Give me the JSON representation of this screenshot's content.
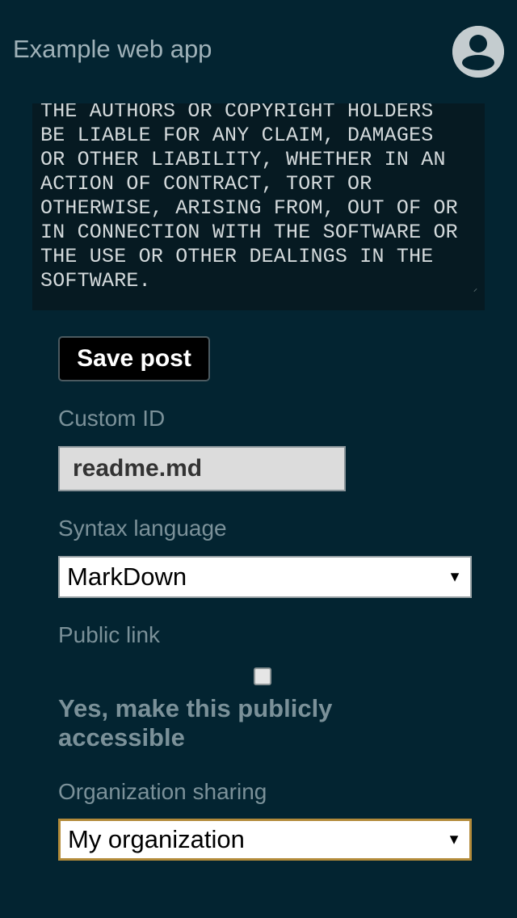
{
  "header": {
    "title": "Example web app",
    "avatar_icon": "account-circle-icon"
  },
  "editor": {
    "content": "THE AUTHORS OR COPYRIGHT HOLDERS\nBE LIABLE FOR ANY CLAIM, DAMAGES\nOR OTHER LIABILITY, WHETHER IN AN\nACTION OF CONTRACT, TORT OR\nOTHERWISE, ARISING FROM, OUT OF OR\nIN CONNECTION WITH THE SOFTWARE OR\nTHE USE OR OTHER DEALINGS IN THE\nSOFTWARE."
  },
  "form": {
    "save_label": "Save post",
    "custom_id": {
      "label": "Custom ID",
      "value": "readme.md"
    },
    "syntax": {
      "label": "Syntax language",
      "value": "MarkDown"
    },
    "public_link": {
      "label": "Public link",
      "checkbox_label": "Yes, make this publicly accessible",
      "checked": false
    },
    "org_sharing": {
      "label": "Organization sharing",
      "value": "My organization"
    }
  },
  "colors": {
    "background": "#032431",
    "editor_background": "#061a22",
    "label": "#7b9199",
    "focus_border": "#b38b3a"
  }
}
